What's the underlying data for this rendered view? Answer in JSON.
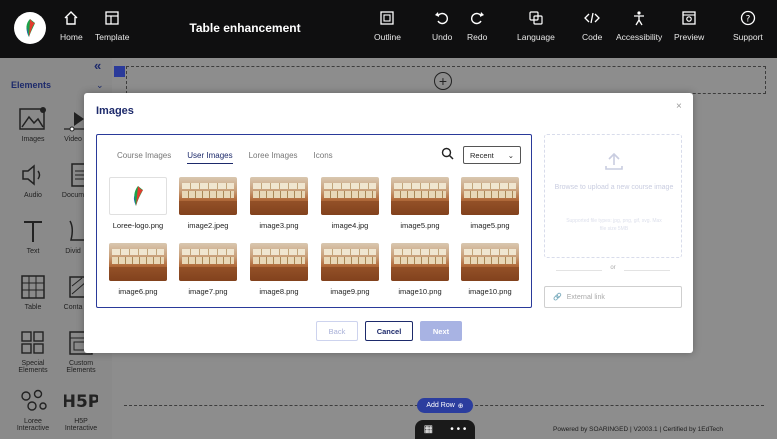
{
  "topbar": {
    "home_label": "Home",
    "template_label": "Template",
    "title": "Table enhancement",
    "outline_label": "Outline",
    "undo_label": "Undo",
    "redo_label": "Redo",
    "language_label": "Language",
    "code_label": "Code",
    "accessibility_label": "Accessibility",
    "preview_label": "Preview",
    "support_label": "Support"
  },
  "sidebar": {
    "collapse_glyph": "«",
    "elements_label": "Elements",
    "items": [
      {
        "label": "Images",
        "icon": "images-icon"
      },
      {
        "label": "Video",
        "icon": "video-icon"
      },
      {
        "label": "Audio",
        "icon": "audio-icon"
      },
      {
        "label": "Docum",
        "icon": "document-icon"
      },
      {
        "label": "Text",
        "icon": "text-icon"
      },
      {
        "label": "Divid",
        "icon": "divider-icon"
      },
      {
        "label": "Table",
        "icon": "table-icon"
      },
      {
        "label": "Conta",
        "icon": "container-icon"
      },
      {
        "label": "Special Elements",
        "icon": "special-elements-icon"
      },
      {
        "label": "Custom Elements",
        "icon": "custom-elements-icon"
      },
      {
        "label": "Loree Interactive",
        "icon": "loree-interactive-icon"
      },
      {
        "label": "H5P Interactive",
        "icon": "h5p-icon"
      }
    ]
  },
  "canvas": {
    "add_row_label": "Add Row",
    "bottom_dots": "• • •",
    "footer": "Powered by SOARINGED | V2003.1 | Certified by 1EdTech"
  },
  "modal": {
    "title": "Images",
    "close_glyph": "×",
    "tabs": [
      "Course Images",
      "User Images",
      "Loree Images",
      "Icons"
    ],
    "active_tab": "User Images",
    "sort_selected": "Recent",
    "images": [
      {
        "name": "Loree-logo.png",
        "kind": "logo"
      },
      {
        "name": "image2.jpeg",
        "kind": "teach"
      },
      {
        "name": "image3.png",
        "kind": "teach"
      },
      {
        "name": "image4.jpg",
        "kind": "teach"
      },
      {
        "name": "image5.png",
        "kind": "teach"
      },
      {
        "name": "image5.png",
        "kind": "teach"
      },
      {
        "name": "image6.png",
        "kind": "teach"
      },
      {
        "name": "image7.png",
        "kind": "teach"
      },
      {
        "name": "image8.png",
        "kind": "teach"
      },
      {
        "name": "image9.png",
        "kind": "teach"
      },
      {
        "name": "image10.png",
        "kind": "teach"
      },
      {
        "name": "image10.png",
        "kind": "teach"
      }
    ],
    "upload_title": "Browse to upload a new course image",
    "upload_sub": "Supported file types: jpg, png, gif, svg. Max file size 5MB",
    "or_label": "or",
    "external_link_placeholder": "External link",
    "back_label": "Back",
    "cancel_label": "Cancel",
    "next_label": "Next"
  },
  "colors": {
    "brand_navy": "#1d2a6b",
    "accent_blue": "#2b3d9e",
    "next_disabled": "#a8b3e3",
    "topbar_bg": "#0f0f10"
  }
}
